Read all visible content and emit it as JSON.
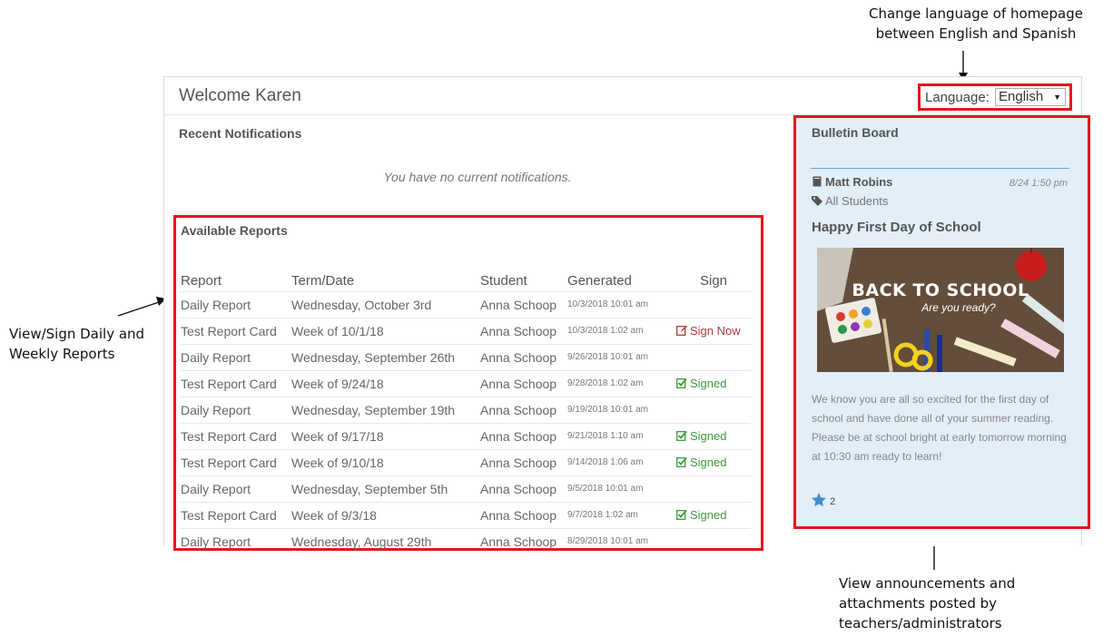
{
  "callouts": {
    "top": "Change language of homepage between English and Spanish",
    "left": "View/Sign Daily and Weekly Reports",
    "bottom": "View announcements and attachments posted by teachers/administrators"
  },
  "header": {
    "welcome": "Welcome Karen",
    "language_label": "Language:",
    "language_selected": "English"
  },
  "notifications": {
    "title": "Recent Notifications",
    "empty_text": "You have no current notifications."
  },
  "reports": {
    "title": "Available Reports",
    "columns": [
      "Report",
      "Term/Date",
      "Student",
      "Generated",
      "Sign"
    ],
    "rows": [
      {
        "report": "Daily Report",
        "term": "Wednesday, October 3rd",
        "student": "Anna Schoop",
        "generated": "10/3/2018 10:01 am",
        "sign": "",
        "status": "none"
      },
      {
        "report": "Test Report Card",
        "term": "Week of 10/1/18",
        "student": "Anna Schoop",
        "generated": "10/3/2018 1:02 am",
        "sign": "Sign Now",
        "status": "sign-now"
      },
      {
        "report": "Daily Report",
        "term": "Wednesday, September 26th",
        "student": "Anna Schoop",
        "generated": "9/26/2018 10:01 am",
        "sign": "",
        "status": "none"
      },
      {
        "report": "Test Report Card",
        "term": "Week of 9/24/18",
        "student": "Anna Schoop",
        "generated": "9/28/2018 1:02 am",
        "sign": "Signed",
        "status": "signed"
      },
      {
        "report": "Daily Report",
        "term": "Wednesday, September 19th",
        "student": "Anna Schoop",
        "generated": "9/19/2018 10:01 am",
        "sign": "",
        "status": "none"
      },
      {
        "report": "Test Report Card",
        "term": "Week of 9/17/18",
        "student": "Anna Schoop",
        "generated": "9/21/2018 1:10 am",
        "sign": "Signed",
        "status": "signed"
      },
      {
        "report": "Test Report Card",
        "term": "Week of 9/10/18",
        "student": "Anna Schoop",
        "generated": "9/14/2018 1:06 am",
        "sign": "Signed",
        "status": "signed"
      },
      {
        "report": "Daily Report",
        "term": "Wednesday, September 5th",
        "student": "Anna Schoop",
        "generated": "9/5/2018 10:01 am",
        "sign": "",
        "status": "none"
      },
      {
        "report": "Test Report Card",
        "term": "Week of 9/3/18",
        "student": "Anna Schoop",
        "generated": "9/7/2018 1:02 am",
        "sign": "Signed",
        "status": "signed"
      },
      {
        "report": "Daily Report",
        "term": "Wednesday, August 29th",
        "student": "Anna Schoop",
        "generated": "8/29/2018 10:01 am",
        "sign": "",
        "status": "none"
      }
    ]
  },
  "bulletin": {
    "title": "Bulletin Board",
    "author": "Matt Robins",
    "date": "8/24 1:50 pm",
    "audience": "All Students",
    "post_title": "Happy First Day of School",
    "image_heading": "BACK TO SCHOOL",
    "image_subheading": "Are you ready?",
    "body": "We know you are all so excited for the first day of school and have done all of your summer reading. Please be at school bright at early tomorrow morning at 10:30 am ready to learn!",
    "likes": "2"
  },
  "colors": {
    "highlight": "#e0191e",
    "bulletin_bg": "#e2eef8",
    "signed": "#3e9a3e",
    "sign_now": "#b03a3a",
    "star": "#3a8fd0"
  },
  "icons": [
    "book-icon",
    "tag-icon",
    "edit-icon",
    "check-icon",
    "star-icon",
    "chevron-down-icon"
  ]
}
